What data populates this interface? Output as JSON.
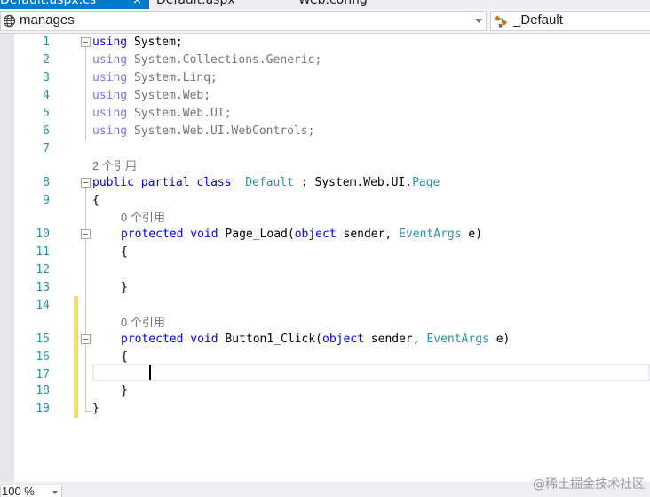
{
  "tabs": [
    {
      "label": "Default.aspx.cs",
      "active": true
    },
    {
      "label": "Default.aspx",
      "active": false
    },
    {
      "label": "Web.config",
      "active": false
    }
  ],
  "tab_close_glyph": "×",
  "navbar": {
    "project": "manages",
    "member": "_Default"
  },
  "editor": {
    "line_numbers": [
      "1",
      "2",
      "3",
      "4",
      "5",
      "6",
      "7",
      "8",
      "9",
      "10",
      "11",
      "12",
      "13",
      "14",
      "15",
      "16",
      "17",
      "18",
      "19"
    ],
    "codelens": {
      "class_refs": "2 个引用",
      "page_load_refs": "0 个引用",
      "button_click_refs": "0 个引用"
    },
    "lines": {
      "l1": {
        "kw": "using",
        "rest": " System;"
      },
      "l2": {
        "kw": "using",
        "rest": " System.Collections.Generic;"
      },
      "l3": {
        "kw": "using",
        "rest": " System.Linq;"
      },
      "l4": {
        "kw": "using",
        "rest": " System.Web;"
      },
      "l5": {
        "kw": "using",
        "rest": " System.Web.UI;"
      },
      "l6": {
        "kw": "using",
        "rest": " System.Web.UI.WebControls;"
      },
      "l8": {
        "kw1": "public",
        "kw2": "partial",
        "kw3": "class",
        "name": "_Default",
        "sep": " : System.Web.UI.",
        "base": "Page"
      },
      "l9": "{",
      "l10": {
        "kw1": "protected",
        "kw2": "void",
        "name": "Page_Load(",
        "kw3": "object",
        "mid": " sender, ",
        "ty": "EventArgs",
        "end": " e)"
      },
      "l11": "{",
      "l13": "}",
      "l15": {
        "kw1": "protected",
        "kw2": "void",
        "name": "Button1_Click(",
        "kw3": "object",
        "mid": " sender, ",
        "ty": "EventArgs",
        "end": " e)"
      },
      "l16": "{",
      "l18": "}",
      "l19": "}"
    }
  },
  "zoom": "100 %",
  "watermark": "@稀土掘金技术社区",
  "colors": {
    "keyword": "#0000ff",
    "type": "#2b91af",
    "line_number": "#2b91af",
    "change_marker": "#efe05b",
    "active_tab": "#007acc"
  }
}
